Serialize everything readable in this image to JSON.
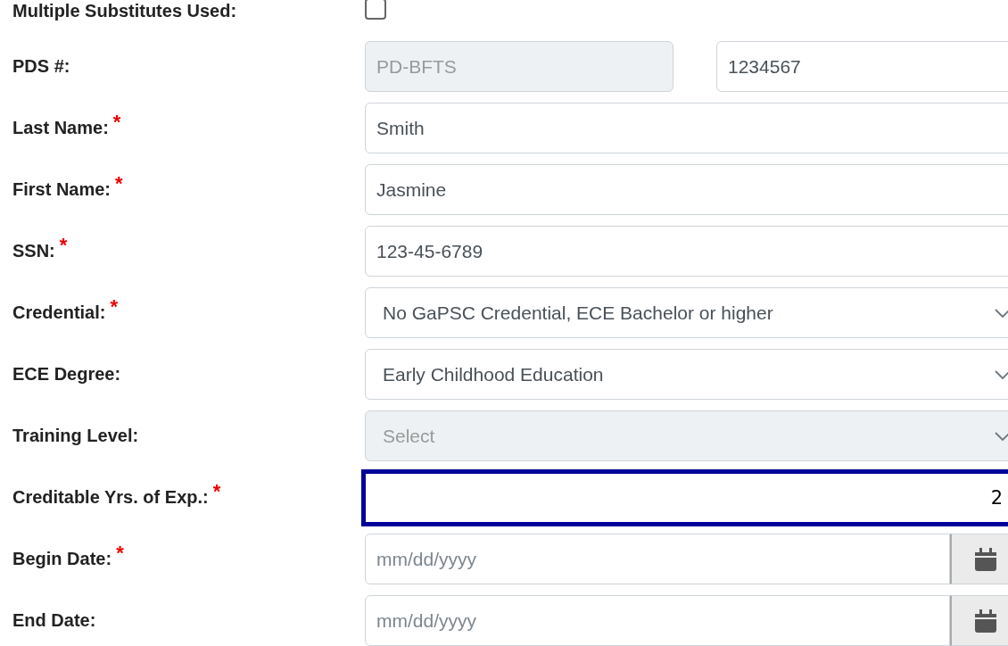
{
  "fields": [
    {
      "kind": "checkbox",
      "label": "Multiple Substitutes Used:",
      "checked": false
    },
    {
      "kind": "pair",
      "label": "PDS #:",
      "prefix": {
        "value": "PD-BFTS",
        "disabled": true
      },
      "value": "1234567"
    },
    {
      "kind": "text",
      "label": "Last Name:",
      "required_mark": "*",
      "value": "Smith"
    },
    {
      "kind": "text",
      "label": "First Name:",
      "required_mark": "*",
      "value": "Jasmine"
    },
    {
      "kind": "text",
      "label": "SSN:",
      "required_mark": "*",
      "value": "123-45-6789"
    },
    {
      "kind": "select",
      "label": "Credential:",
      "required_mark": "*",
      "value": "No GaPSC Credential, ECE Bachelor or higher",
      "disabled": false
    },
    {
      "kind": "select",
      "label": "ECE Degree:",
      "value": "Early Childhood Education",
      "disabled": false
    },
    {
      "kind": "select",
      "label": "Training Level:",
      "placeholder": "Select",
      "disabled": true
    },
    {
      "kind": "number",
      "label": "Creditable Yrs. of Exp.:",
      "required_mark": "*",
      "value": "2",
      "focused": true
    },
    {
      "kind": "date",
      "label": "Begin Date:",
      "required_mark": "*",
      "placeholder": "mm/dd/yyyy"
    },
    {
      "kind": "date",
      "label": "End Date:",
      "placeholder": "mm/dd/yyyy"
    }
  ]
}
